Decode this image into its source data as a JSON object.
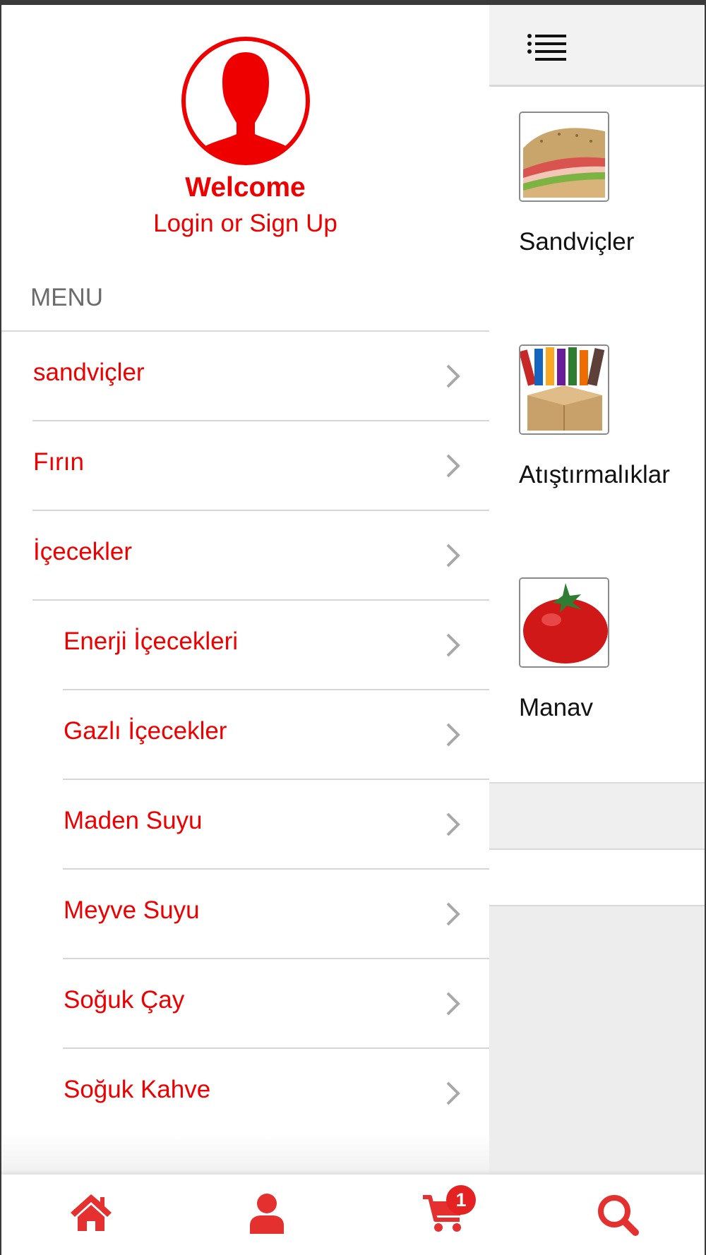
{
  "colors": {
    "accent": "#ee0000",
    "text": "#111111",
    "muted": "#6b6b6b",
    "icon_red": "#e53030"
  },
  "header": {
    "menu_icon": "hamburger-icon"
  },
  "drawer": {
    "avatar_icon": "user-avatar-icon",
    "welcome": "Welcome",
    "login_link": "Login or Sign Up",
    "menu_heading": "MENU",
    "items": [
      {
        "label": "sandviçler"
      },
      {
        "label": "Fırın"
      },
      {
        "label": "İçecekler"
      },
      {
        "label": "Enerji İçecekleri"
      },
      {
        "label": "Gazlı İçecekler"
      },
      {
        "label": "Maden Suyu"
      },
      {
        "label": "Meyve Suyu"
      },
      {
        "label": "Soğuk Çay"
      },
      {
        "label": "Soğuk Kahve"
      }
    ]
  },
  "categories": [
    {
      "name": "Sandviçler"
    },
    {
      "name": "Atıştırmalıklar"
    },
    {
      "name": "Manav"
    }
  ],
  "tabbar": {
    "tabs": [
      {
        "icon": "home-icon"
      },
      {
        "icon": "user-icon"
      },
      {
        "icon": "cart-icon"
      },
      {
        "icon": "search-icon"
      }
    ],
    "cart_badge": "1"
  }
}
